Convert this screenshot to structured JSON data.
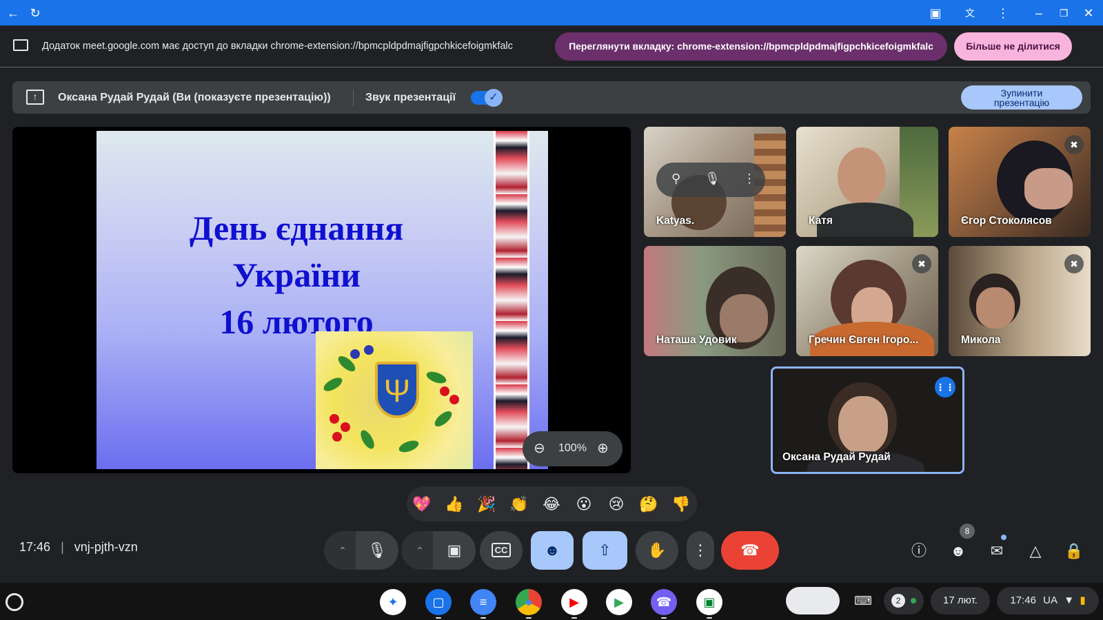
{
  "share_bar": {
    "notice": "Додаток meet.google.com має доступ до вкладки chrome-extension://bpmcpldpdmajfigpchkicefoigmkfalc",
    "view_tab_label": "Переглянути вкладку: chrome-extension://bpmcpldpdmajfigpchkicefoigmkfalc",
    "stop_sharing_label": "Більше не ділитися"
  },
  "present_banner": {
    "presenter": "Оксана Рудай Рудай (Ви (показуєте презентацію))",
    "audio_label": "Звук презентації",
    "audio_enabled": true,
    "stop_label_line1": "Зупинити",
    "stop_label_line2": "презентацію"
  },
  "slide": {
    "line1": "День єднання",
    "line2": "України",
    "line3": "16 лютого"
  },
  "zoom": {
    "level": "100%"
  },
  "tiles": [
    {
      "name": "Katyas.",
      "muted": false
    },
    {
      "name": "Катя",
      "muted": false
    },
    {
      "name": "Єгор Стоколясов",
      "muted": true
    },
    {
      "name": "Наташа Удовик",
      "muted": false
    },
    {
      "name": "Гречин Євген Ігоро...",
      "muted": true
    },
    {
      "name": "Микола",
      "muted": true
    }
  ],
  "self_tile": {
    "name": "Оксана Рудай Рудай",
    "speaking": true
  },
  "reactions": [
    "💖",
    "👍",
    "🎉",
    "👏",
    "😂",
    "😮",
    "😢",
    "🤔",
    "👎"
  ],
  "meeting": {
    "time": "17:46",
    "code": "vnj-pjth-vzn",
    "separator": "|"
  },
  "people": {
    "count": "8"
  },
  "system_tray": {
    "notifications": "2",
    "date": "17 лют.",
    "time": "17:46",
    "locale": "UA"
  },
  "colors": {
    "accent": "#1a73e8",
    "end_call": "#ea4335",
    "active_control": "#a8c7fa"
  }
}
